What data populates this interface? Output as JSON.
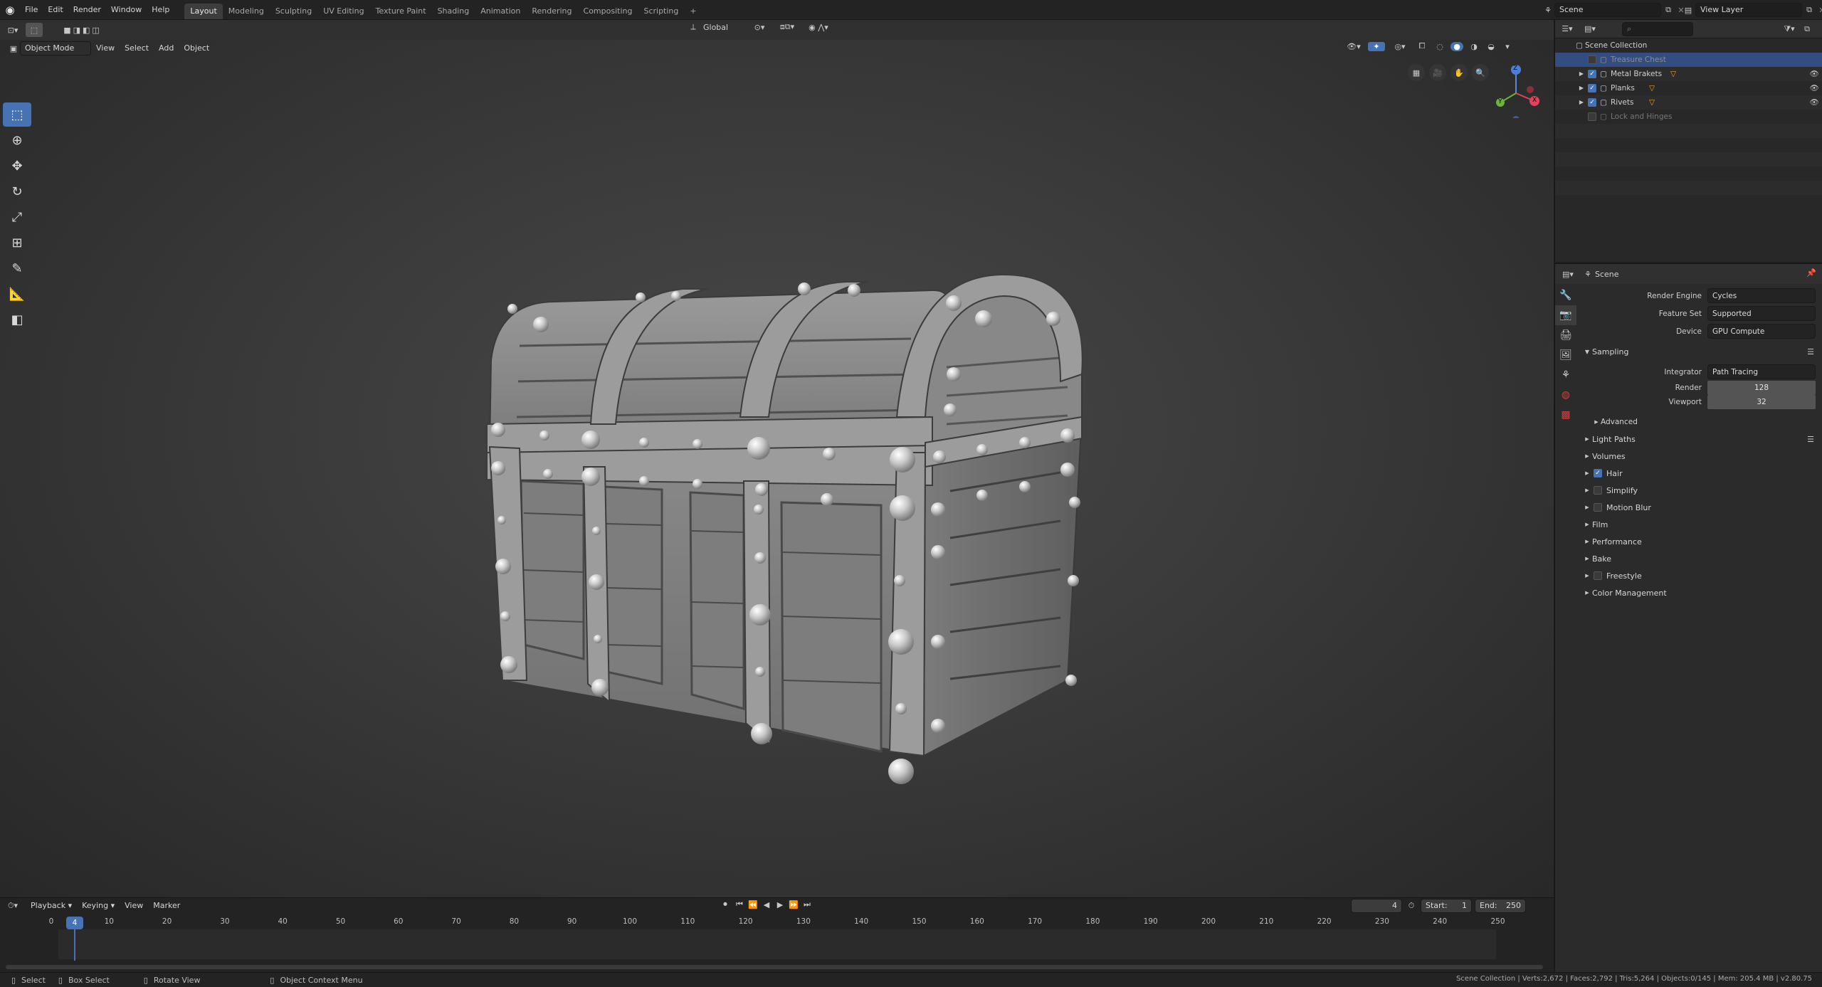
{
  "topbar": {
    "menus": [
      "File",
      "Edit",
      "Render",
      "Window",
      "Help"
    ],
    "workspaces": [
      "Layout",
      "Modeling",
      "Sculpting",
      "UV Editing",
      "Texture Paint",
      "Shading",
      "Animation",
      "Rendering",
      "Compositing",
      "Scripting"
    ],
    "active_workspace": "Layout",
    "add_tab": "+",
    "scene_name": "Scene",
    "view_layer": "View Layer"
  },
  "viewport_header": {
    "mode": "Object Mode",
    "menus": [
      "View",
      "Select",
      "Add",
      "Object"
    ],
    "orientation": "Global"
  },
  "gizmo": {
    "z": "Z",
    "x": "X",
    "y": "Y"
  },
  "outliner": {
    "root": "Scene Collection",
    "items": [
      {
        "label": "Treasure Chest",
        "checked": false,
        "selected": true,
        "visible": false
      },
      {
        "label": "Metal Brakets",
        "checked": true,
        "selected": false,
        "visible": true
      },
      {
        "label": "Planks",
        "checked": true,
        "selected": false,
        "visible": true
      },
      {
        "label": "Rivets",
        "checked": true,
        "selected": false,
        "visible": true
      },
      {
        "label": "Lock and Hinges",
        "checked": false,
        "selected": false,
        "visible": false
      }
    ]
  },
  "properties": {
    "context": "Scene",
    "render_engine_label": "Render Engine",
    "render_engine": "Cycles",
    "feature_set_label": "Feature Set",
    "feature_set": "Supported",
    "device_label": "Device",
    "device": "GPU Compute",
    "sampling": {
      "title": "Sampling",
      "integrator_label": "Integrator",
      "integrator": "Path Tracing",
      "render_label": "Render",
      "render": "128",
      "viewport_label": "Viewport",
      "viewport": "32",
      "advanced": "Advanced"
    },
    "panels": [
      {
        "label": "Light Paths",
        "checkbox": null
      },
      {
        "label": "Volumes",
        "checkbox": null
      },
      {
        "label": "Hair",
        "checkbox": true
      },
      {
        "label": "Simplify",
        "checkbox": false
      },
      {
        "label": "Motion Blur",
        "checkbox": false
      },
      {
        "label": "Film",
        "checkbox": null
      },
      {
        "label": "Performance",
        "checkbox": null
      },
      {
        "label": "Bake",
        "checkbox": null
      },
      {
        "label": "Freestyle",
        "checkbox": false
      },
      {
        "label": "Color Management",
        "checkbox": null
      }
    ]
  },
  "timeline": {
    "menus": [
      "Playback",
      "Keying",
      "View",
      "Marker"
    ],
    "current_frame": "4",
    "start_label": "Start:",
    "start": "1",
    "end_label": "End:",
    "end": "250",
    "ticks": [
      "0",
      "10",
      "20",
      "30",
      "40",
      "50",
      "60",
      "70",
      "80",
      "90",
      "100",
      "110",
      "120",
      "130",
      "140",
      "150",
      "160",
      "170",
      "180",
      "190",
      "200",
      "210",
      "220",
      "230",
      "240",
      "250"
    ]
  },
  "statusbar": {
    "select": "Select",
    "box_select": "Box Select",
    "rotate_view": "Rotate View",
    "context_menu": "Object Context Menu",
    "stats": "Scene Collection | Verts:2,672 | Faces:2,792 | Tris:5,264 | Objects:0/145 | Mem: 205.4 MB | v2.80.75"
  },
  "colors": {
    "accent": "#4772b3",
    "selection": "#334d80",
    "keyframe_current": "#4772b3"
  }
}
